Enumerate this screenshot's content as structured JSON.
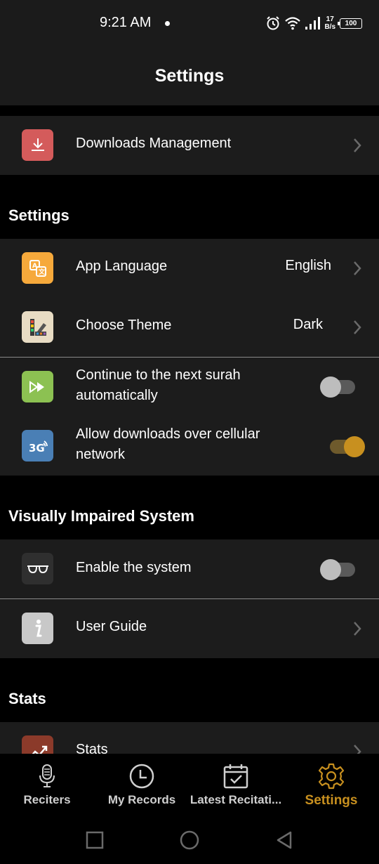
{
  "status_bar": {
    "time": "9:21 AM",
    "net_speed_value": "17",
    "net_speed_unit": "B/s",
    "battery": "100"
  },
  "header": {
    "title": "Settings"
  },
  "downloads": {
    "label": "Downloads Management",
    "icon": "download-icon",
    "icon_color": "#d45b5b"
  },
  "sections": {
    "settings": "Settings",
    "visually_impaired": "Visually Impaired System",
    "stats": "Stats"
  },
  "settings_items": {
    "app_language": {
      "label": "App Language",
      "value": "English",
      "icon": "language-icon",
      "icon_color": "#f6a93b"
    },
    "choose_theme": {
      "label": "Choose Theme",
      "value": "Dark",
      "icon": "palette-icon",
      "icon_color": "#e8dcc4"
    },
    "continue_next": {
      "label_line1": "Continue to the next surah",
      "label_line2": "automatically",
      "enabled": false,
      "icon": "fast-forward-icon",
      "icon_color": "#8cc152"
    },
    "cellular": {
      "label_line1": "Allow downloads over cellular",
      "label_line2": "network",
      "enabled": true,
      "icon": "3g-icon",
      "icon_color": "#4a7fb5"
    }
  },
  "visually_impaired_items": {
    "enable_system": {
      "label": "Enable the system",
      "enabled": false,
      "icon": "glasses-icon",
      "icon_color": "#2f2f2f"
    },
    "user_guide": {
      "label": "User Guide",
      "icon": "info-icon",
      "icon_color": "#c8c8c8"
    }
  },
  "stats_items": {
    "stats": {
      "label": "Stats",
      "icon": "chart-icon",
      "icon_color": "#8b3a2a"
    }
  },
  "bottom_nav": {
    "reciters": "Reciters",
    "my_records": "My Records",
    "latest_recitations": "Latest Recitati...",
    "settings": "Settings",
    "active": "settings",
    "active_color": "#c8901f"
  }
}
